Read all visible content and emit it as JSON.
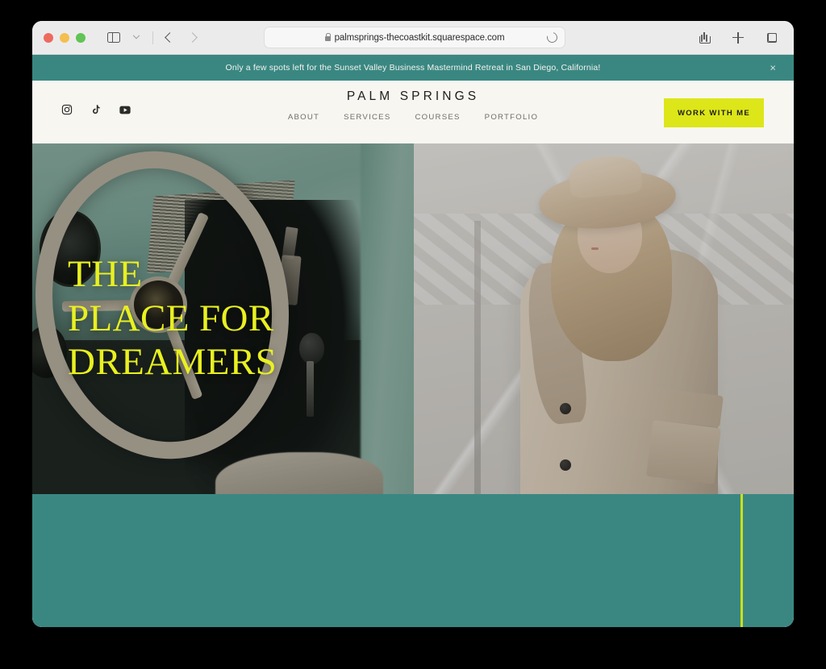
{
  "browser": {
    "traffic_lights": [
      "close",
      "minimize",
      "maximize"
    ],
    "sidebar_icon": "sidebar-icon",
    "tab_overview_chevron": "chevron-down-icon",
    "back_label": "Back",
    "forward_label": "Forward",
    "url": "palmsprings-thecoastkit.squarespace.com",
    "lock_icon": "lock-icon",
    "reload_icon": "reload-icon",
    "share_icon": "share-icon",
    "new_tab_icon": "plus-icon",
    "tabs_icon": "tab-overview-icon"
  },
  "announcement": {
    "text": "Only a few spots left for the Sunset Valley Business Mastermind Retreat in San Diego, California!",
    "close_label": "×",
    "background": "#3A8782",
    "text_color": "#F3F3EF"
  },
  "header": {
    "brand": "PALM SPRINGS",
    "background": "#F8F6F1",
    "socials": [
      {
        "name": "instagram",
        "label": "Instagram"
      },
      {
        "name": "tiktok",
        "label": "TikTok"
      },
      {
        "name": "youtube",
        "label": "YouTube"
      }
    ],
    "nav": [
      {
        "label": "ABOUT"
      },
      {
        "label": "SERVICES"
      },
      {
        "label": "COURSES"
      },
      {
        "label": "PORTFOLIO"
      }
    ],
    "cta": {
      "label": "WORK WITH ME",
      "background": "#DDE619",
      "text_color": "#1D1D1B"
    }
  },
  "hero": {
    "headline_line1": "THE",
    "headline_line2": "PLACE FOR",
    "headline_line3": "DREAMERS",
    "headline_color": "#E9F020",
    "left_image_alt": "vintage car interior with mint dashboard and ivory steering wheel",
    "right_image_alt": "woman in beige wide-brim hat and trench coat"
  },
  "band": {
    "background": "#3A8782",
    "accent_rule_color": "#C9E01A"
  }
}
